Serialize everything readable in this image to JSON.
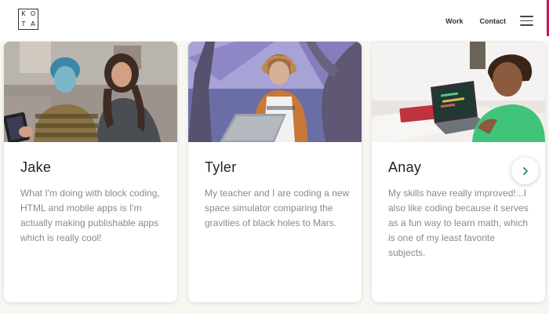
{
  "header": {
    "logo_letters": [
      "K",
      "O",
      "T",
      "A"
    ],
    "nav": {
      "work": "Work",
      "contact": "Contact"
    }
  },
  "colors": {
    "accent": "#c2185b",
    "next_arrow": "#3b9a6b",
    "quote_text": "#8a8a8a"
  },
  "cards": [
    {
      "name": "Jake",
      "quote": "What I'm doing with block coding, HTML and mobile apps is I'm actually making publishable apps which is really cool!"
    },
    {
      "name": "Tyler",
      "quote": "My teacher and I are coding a new space simulator comparing the gravities of black holes to Mars."
    },
    {
      "name": "Anay",
      "quote": "My skills have really improved!...I also like coding because it serves as a fun way to learn math, which is one of my least favorite subjects."
    }
  ],
  "carousel": {
    "next_icon": "chevron-right-icon"
  }
}
